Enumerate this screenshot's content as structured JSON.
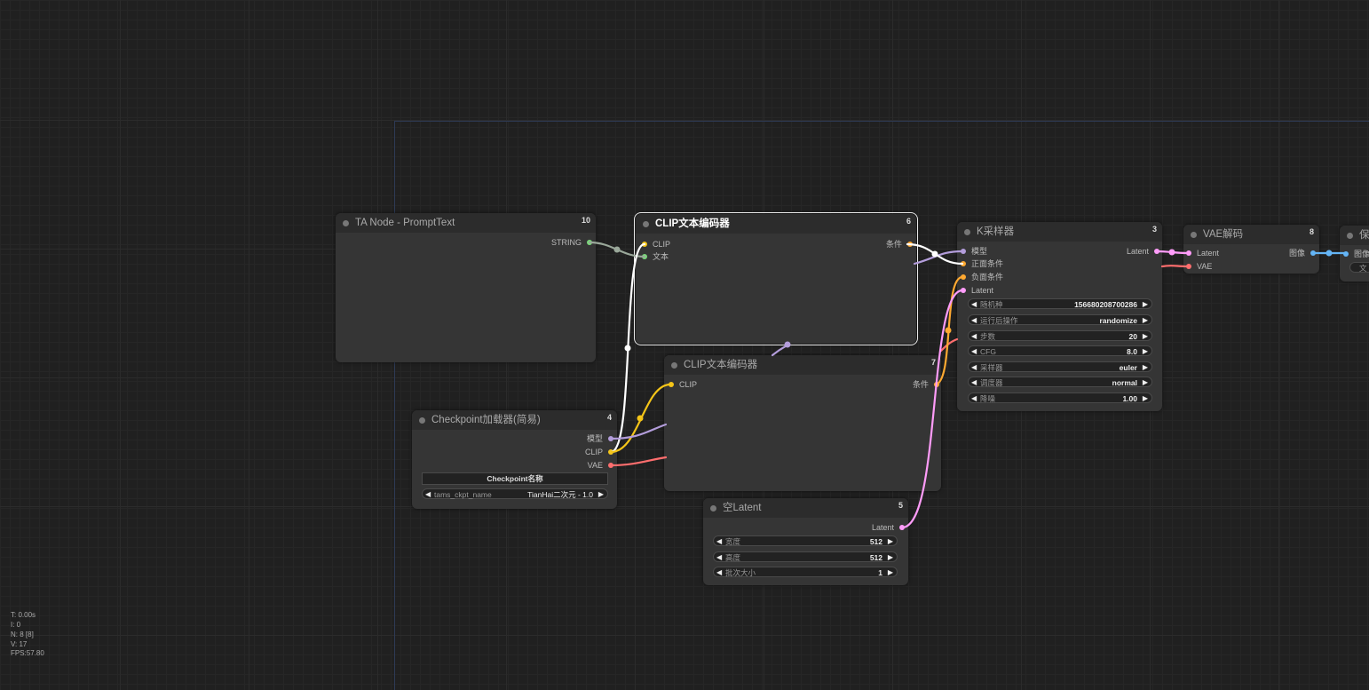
{
  "nodes": {
    "prompt_text": {
      "title": "TA Node - PromptText",
      "id": "10",
      "outputs": [
        "STRING"
      ]
    },
    "clip_encoder_6": {
      "title": "CLIP文本编码器",
      "id": "6",
      "inputs": [
        "CLIP",
        "文本"
      ],
      "outputs": [
        "条件"
      ]
    },
    "clip_encoder_7": {
      "title": "CLIP文本编码器",
      "id": "7",
      "inputs": [
        "CLIP"
      ],
      "outputs": [
        "条件"
      ]
    },
    "checkpoint_loader": {
      "title": "Checkpoint加载器(简易)",
      "id": "4",
      "outputs": [
        "模型",
        "CLIP",
        "VAE"
      ],
      "button_label": "Checkpoint名称",
      "widget": {
        "label": "tams_ckpt_name",
        "value": "TianHai二次元 - 1.0"
      }
    },
    "ksampler": {
      "title": "K采样器",
      "id": "3",
      "inputs": [
        "模型",
        "正面条件",
        "负面条件",
        "Latent"
      ],
      "outputs": [
        "Latent"
      ],
      "widgets": [
        {
          "label": "随机种",
          "value": "156680208700286"
        },
        {
          "label": "运行后操作",
          "value": "randomize"
        },
        {
          "label": "步数",
          "value": "20"
        },
        {
          "label": "CFG",
          "value": "8.0"
        },
        {
          "label": "采样器",
          "value": "euler"
        },
        {
          "label": "调度器",
          "value": "normal"
        },
        {
          "label": "降噪",
          "value": "1.00"
        }
      ]
    },
    "vae_decode": {
      "title": "VAE解码",
      "id": "8",
      "inputs": [
        "Latent",
        "VAE"
      ],
      "outputs": [
        "图像"
      ]
    },
    "save_image": {
      "title": "保",
      "inputs": [
        "图像"
      ],
      "widget_value": "文"
    },
    "empty_latent": {
      "title": "空Latent",
      "id": "5",
      "outputs": [
        "Latent"
      ],
      "widgets": [
        {
          "label": "宽度",
          "value": "512"
        },
        {
          "label": "高度",
          "value": "512"
        },
        {
          "label": "批次大小",
          "value": "1"
        }
      ]
    }
  },
  "stats": {
    "t": "T: 0.00s",
    "i": "I: 0",
    "n": "N: 8 [8]",
    "v": "V: 17",
    "fps": "FPS:57.80"
  },
  "colors": {
    "clip": "#f5c518",
    "model": "#b39ddb",
    "vae": "#ff6e6e",
    "latent": "#ff9cf9",
    "conditioning": "#ffa931",
    "image": "#64b5f6",
    "string": "#7bd87b",
    "selected_link": "#ffffff"
  }
}
